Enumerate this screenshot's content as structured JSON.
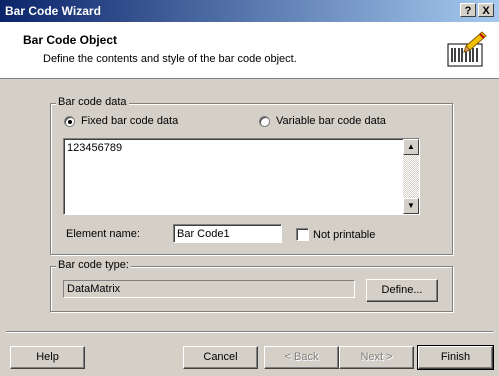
{
  "window": {
    "title": "Bar Code Wizard",
    "help_btn": "?",
    "close_btn": "X"
  },
  "header": {
    "title": "Bar Code Object",
    "subtitle": "Define the contents and style of the bar code object.",
    "icon": "barcode-pen-icon"
  },
  "barcode_data": {
    "legend": "Bar code data",
    "fixed_label": "Fixed bar code data",
    "variable_label": "Variable bar code data",
    "selected": "fixed",
    "value": "123456789",
    "element_name_label": "Element name:",
    "element_name_value": "Bar Code1",
    "not_printable_label": "Not printable",
    "not_printable_checked": false
  },
  "barcode_type": {
    "legend": "Bar code type:",
    "value": "DataMatrix",
    "define_label": "Define..."
  },
  "buttons": {
    "help": "Help",
    "cancel": "Cancel",
    "back": "< Back",
    "next": "Next >",
    "finish": "Finish"
  }
}
